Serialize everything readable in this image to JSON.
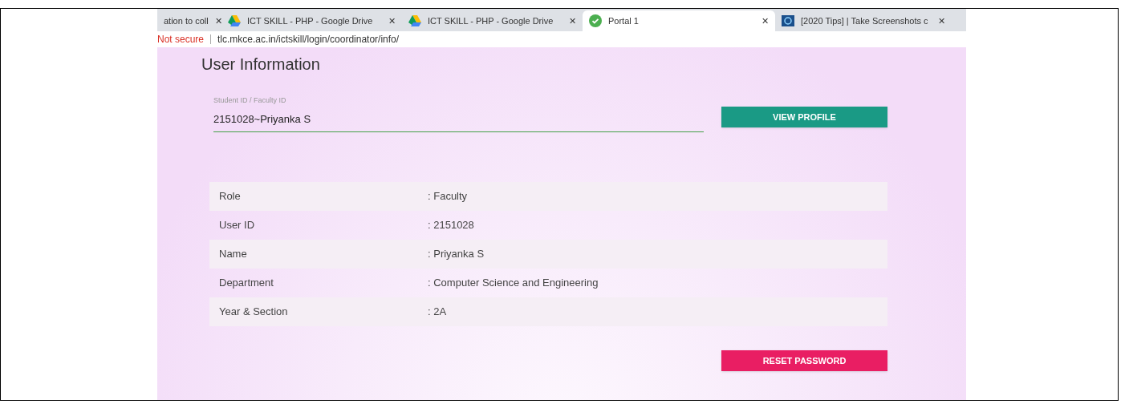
{
  "browser": {
    "tabs": [
      {
        "title": "ation to coll",
        "kind": "plain",
        "close": "✕",
        "selected": false
      },
      {
        "title": "ICT SKILL - PHP - Google Drive",
        "kind": "drive",
        "close": "✕",
        "selected": false
      },
      {
        "title": "ICT SKILL - PHP - Google Drive",
        "kind": "drive",
        "close": "✕",
        "selected": false
      },
      {
        "title": "Portal 1",
        "kind": "check",
        "close": "✕",
        "selected": true
      },
      {
        "title": "[2020 Tips] | Take Screenshots c",
        "kind": "site",
        "close": "✕",
        "selected": false
      }
    ],
    "security": "Not secure",
    "url": "tlc.mkce.ac.in/ictskill/login/coordinator/info/"
  },
  "page": {
    "title": "User Information",
    "field": {
      "label": "Student ID / Faculty ID",
      "value": "2151028~Priyanka S"
    },
    "view_button": "VIEW PROFILE",
    "rows": [
      {
        "label": "Role",
        "value": ": Faculty"
      },
      {
        "label": "User ID",
        "value": ": 2151028"
      },
      {
        "label": "Name",
        "value": ": Priyanka S"
      },
      {
        "label": "Department",
        "value": ": Computer Science and Engineering"
      },
      {
        "label": "Year & Section",
        "value": ": 2A"
      }
    ],
    "reset_button": "RESET PASSWORD"
  }
}
